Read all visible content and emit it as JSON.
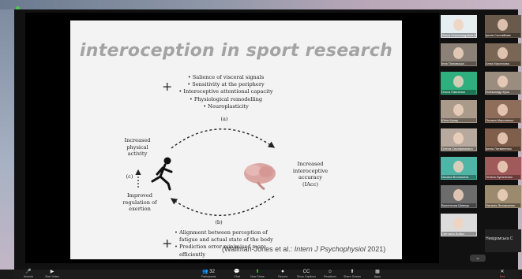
{
  "slide": {
    "title": "interoception  in sport research",
    "top_plus": "+",
    "top_bullets": [
      "• Salience of visceral signals",
      "• Sensitivity at the periphery",
      "• Interoceptive attentional capacity",
      "• Physiological remodelling",
      "• Neuroplasticity"
    ],
    "label_a": "(a)",
    "label_b": "(b)",
    "label_c": "(c)",
    "left_top_label": [
      "Increased",
      "physical",
      "activity"
    ],
    "left_bottom_label": [
      "Improved",
      "regulation of",
      "exertion"
    ],
    "right_label": [
      "Increased",
      "interoceptive",
      "accuracy",
      "(IAcc)"
    ],
    "bottom_plus": "+",
    "bottom_bullets": [
      "• Alignment between perception of",
      "fatigue and actual state of the body",
      "• Prediction error minimised more",
      "efficiently"
    ],
    "citation": {
      "prefix": "(Wallman-Jones et al.: ",
      "journal": "Intern J Psychophysiol",
      "suffix": " 2021)"
    }
  },
  "gallery": {
    "tiles": [
      {
        "name": "Ольга Олександрівна Кіпусь",
        "color": "#e7eef2"
      },
      {
        "name": "Ірина Соловйова",
        "color": "#6a5a4c"
      },
      {
        "name": "Інна Поповська",
        "color": "#8b8176"
      },
      {
        "name": "Анна Масліхова",
        "color": "#7a6655"
      },
      {
        "name": "Ольга Павленко",
        "color": "#2fae7e"
      },
      {
        "name": "Олександр Кузь",
        "color": "#9a8d80"
      },
      {
        "name": "Юлія Кухар",
        "color": "#a99a8a"
      },
      {
        "name": "Оксана Мироненко",
        "color": "#8e6e5a"
      },
      {
        "name": "Олена Серафимович",
        "color": "#b7a99d"
      },
      {
        "name": "Ірина Литвиненко",
        "color": "#7f5f4c"
      },
      {
        "name": "Оксана Волошина",
        "color": "#4fb6a7"
      },
      {
        "name": "Тетяна Лук'яненко",
        "color": "#a15a5a"
      },
      {
        "name": "Валентина Шевчук",
        "color": "#6c6c6c"
      },
      {
        "name": "Наталія Литовченко",
        "color": "#9c8a6f"
      },
      {
        "name": "Світлана Бойко",
        "color": "#dcdcdc"
      }
    ],
    "text_tile": "Невідомська С",
    "arrow": "⌄"
  },
  "toolbar": {
    "items": [
      {
        "label": "Unmute",
        "icon": "🎤"
      },
      {
        "label": "Start Video",
        "icon": "▶"
      },
      {
        "label": "Participants",
        "icon": "👥 32"
      },
      {
        "label": "Chat",
        "icon": "💬"
      },
      {
        "label": "New Share",
        "icon": "⬆"
      },
      {
        "label": "Record",
        "icon": "⏺"
      },
      {
        "label": "Show Captions",
        "icon": "CC"
      },
      {
        "label": "Reactions",
        "icon": "☺"
      },
      {
        "label": "Share Screen",
        "icon": "⬆"
      },
      {
        "label": "Apps",
        "icon": "▦"
      }
    ],
    "end": {
      "label": "End",
      "icon": "✕"
    }
  },
  "colors": {
    "accent_green": "#2fd05a",
    "end_red": "#ff5c5c"
  }
}
